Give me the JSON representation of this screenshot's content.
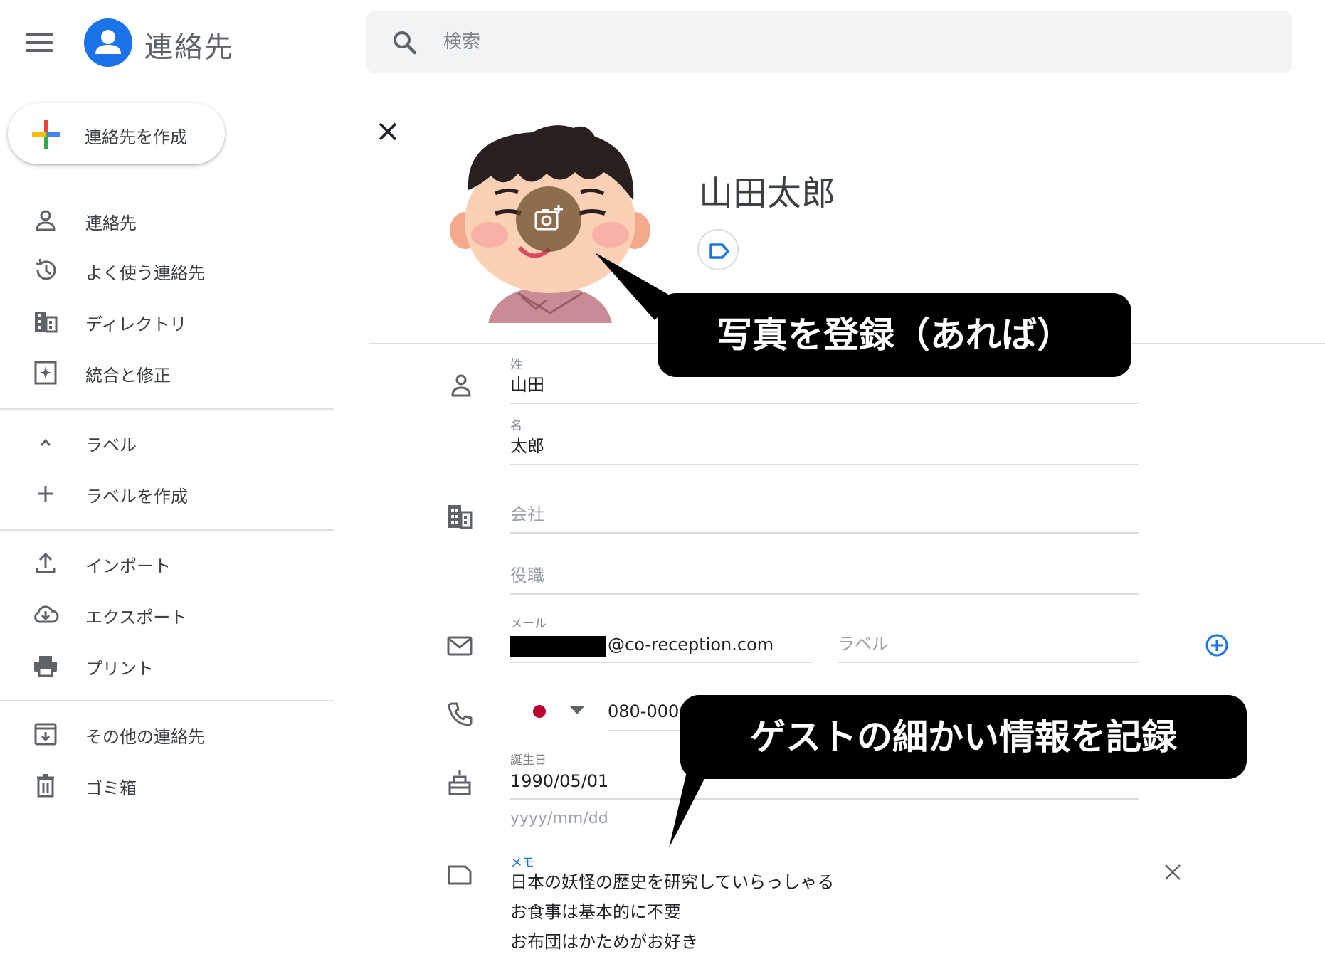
{
  "header": {
    "menu_icon": "hamburger-menu-icon",
    "app_title": "連絡先",
    "logo_icon": "person-circle-icon",
    "search": {
      "placeholder": "検索",
      "icon": "search-icon"
    }
  },
  "sidebar": {
    "create_button": "連絡先を作成",
    "items": [
      {
        "label": "連絡先",
        "icon": "person-outline-icon"
      },
      {
        "label": "よく使う連絡先",
        "icon": "history-icon"
      },
      {
        "label": "ディレクトリ",
        "icon": "domain-icon"
      },
      {
        "label": "統合と修正",
        "icon": "auto-fix-icon"
      }
    ],
    "label_section": {
      "header": "ラベル",
      "create": "ラベルを作成"
    },
    "tools": [
      {
        "label": "インポート",
        "icon": "upload-icon"
      },
      {
        "label": "エクスポート",
        "icon": "cloud-download-icon"
      },
      {
        "label": "プリント",
        "icon": "print-icon"
      }
    ],
    "bottom": [
      {
        "label": "その他の連絡先",
        "icon": "archive-icon"
      },
      {
        "label": "ゴミ箱",
        "icon": "trash-icon"
      }
    ]
  },
  "editor": {
    "contact_name": "山田太郎",
    "fields": {
      "last_name": {
        "label": "姓",
        "value": "山田"
      },
      "first_name": {
        "label": "名",
        "value": "太郎"
      },
      "company": {
        "placeholder": "会社"
      },
      "job_title": {
        "placeholder": "役職"
      },
      "email": {
        "label": "メール",
        "domain": "@co-reception.com",
        "label_placeholder": "ラベル"
      },
      "phone": {
        "value": "080-0000"
      },
      "birthday": {
        "label": "誕生日",
        "value": "1990/05/01"
      },
      "date_format": {
        "placeholder": "yyyy/mm/dd"
      },
      "memo": {
        "label": "メモ",
        "lines": [
          "日本の妖怪の歴史を研究していらっしゃる",
          "お食事は基本的に不要",
          "お布団はかためがお好き"
        ]
      }
    }
  },
  "annotations": {
    "photo_callout": "写真を登録（あれば）",
    "detail_callout": "ゲストの細かい情報を記録"
  },
  "colors": {
    "accent": "#1a73e8",
    "icon_gray": "#5f6368",
    "divider": "#e0e0e0",
    "callout_bg": "#000000",
    "flag_red": "#bc002d"
  }
}
